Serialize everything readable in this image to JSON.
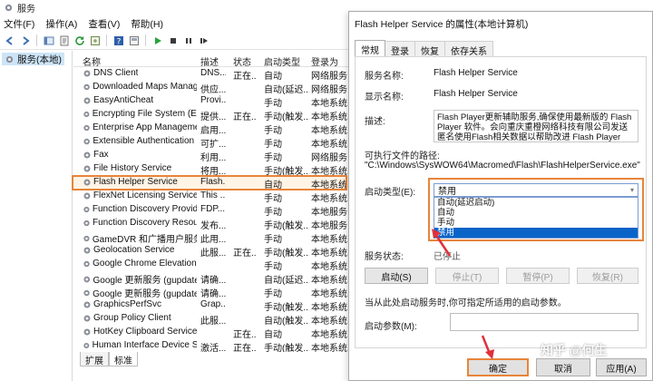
{
  "window": {
    "title": "服务",
    "menu": [
      "文件(F)",
      "操作(A)",
      "查看(V)",
      "帮助(H)"
    ],
    "tree_item": "服务(本地)",
    "bottom_tabs": [
      "扩展",
      "标准"
    ]
  },
  "columns": [
    "名称",
    "描述",
    "状态",
    "启动类型",
    "登录为"
  ],
  "services": [
    {
      "name": "DNS Client",
      "desc": "DNS...",
      "status": "正在...",
      "start": "自动",
      "logon": "网络服务"
    },
    {
      "name": "Downloaded Maps Manager",
      "desc": "供应...",
      "status": "",
      "start": "自动(延迟...",
      "logon": "网络服务"
    },
    {
      "name": "EasyAntiCheat",
      "desc": "Provi...",
      "status": "",
      "start": "手动",
      "logon": "本地系统"
    },
    {
      "name": "Encrypting File System (EFS)",
      "desc": "提供...",
      "status": "正在...",
      "start": "手动(触发...",
      "logon": "本地系统"
    },
    {
      "name": "Enterprise App Manageme...",
      "desc": "启用...",
      "status": "",
      "start": "手动",
      "logon": "本地系统"
    },
    {
      "name": "Extensible Authentication ...",
      "desc": "可扩...",
      "status": "",
      "start": "手动",
      "logon": "本地系统"
    },
    {
      "name": "Fax",
      "desc": "利用...",
      "status": "",
      "start": "手动",
      "logon": "网络服务"
    },
    {
      "name": "File History Service",
      "desc": "将用...",
      "status": "",
      "start": "手动(触发...",
      "logon": "本地系统"
    },
    {
      "name": "Flash Helper Service",
      "desc": "Flash...",
      "status": "",
      "start": "自动",
      "logon": "本地系统"
    },
    {
      "name": "FlexNet Licensing Service",
      "desc": "This ...",
      "status": "",
      "start": "手动",
      "logon": "本地系统"
    },
    {
      "name": "Function Discovery Provide...",
      "desc": "FDP...",
      "status": "",
      "start": "手动",
      "logon": "本地服务"
    },
    {
      "name": "Function Discovery Resour...",
      "desc": "发布...",
      "status": "",
      "start": "手动(触发...",
      "logon": "本地服务"
    },
    {
      "name": "GameDVR 和广播用户服务...",
      "desc": "此用...",
      "status": "",
      "start": "手动",
      "logon": "本地系统"
    },
    {
      "name": "Geolocation Service",
      "desc": "此服...",
      "status": "正在...",
      "start": "手动(触发...",
      "logon": "本地系统"
    },
    {
      "name": "Google Chrome Elevation ...",
      "desc": "",
      "status": "",
      "start": "手动",
      "logon": "本地系统"
    },
    {
      "name": "Google 更新服务 (gupdate)",
      "desc": "请确...",
      "status": "",
      "start": "自动(延迟...",
      "logon": "本地系统"
    },
    {
      "name": "Google 更新服务 (gupdate...",
      "desc": "请确...",
      "status": "",
      "start": "手动",
      "logon": "本地系统"
    },
    {
      "name": "GraphicsPerfSvc",
      "desc": "Grap...",
      "status": "",
      "start": "手动(触发...",
      "logon": "本地系统"
    },
    {
      "name": "Group Policy Client",
      "desc": "此服...",
      "status": "",
      "start": "自动(触发...",
      "logon": "本地系统"
    },
    {
      "name": "HotKey Clipboard Service",
      "desc": "",
      "status": "正在...",
      "start": "自动",
      "logon": "本地系统"
    },
    {
      "name": "Human Interface Device Ser...",
      "desc": "激活...",
      "status": "正在...",
      "start": "手动(触发...",
      "logon": "本地系统"
    }
  ],
  "dialog": {
    "title": "Flash Helper Service 的属性(本地计算机)",
    "tabs": [
      "常规",
      "登录",
      "恢复",
      "依存关系"
    ],
    "service_name_label": "服务名称:",
    "service_name": "Flash Helper Service",
    "display_name_label": "显示名称:",
    "display_name": "Flash Helper Service",
    "desc_label": "描述:",
    "description": "Flash Player更新辅助服务,确保使用最新版的 Flash Player 软件。会向重庆重橙网络科技有限公司发送匿名使用Flash相关数据以帮助改进 Flash Player",
    "path_label": "可执行文件的路径:",
    "path": "\"C:\\Windows\\SysWOW64\\Macromed\\Flash\\FlashHelperService.exe\"",
    "startup_label": "启动类型(E):",
    "startup_selected": "禁用",
    "startup_options": [
      "自动(延迟启动)",
      "自动",
      "手动",
      "禁用"
    ],
    "status_label": "服务状态:",
    "status_value": "已停止",
    "btn_start": "启动(S)",
    "btn_stop": "停止(T)",
    "btn_pause": "暂停(P)",
    "btn_resume": "恢复(R)",
    "hint": "当从此处启动服务时,你可指定所适用的启动参数。",
    "param_label": "启动参数(M):",
    "ok": "确定",
    "cancel": "取消",
    "apply": "应用(A)"
  },
  "watermark": "知乎 @何生",
  "colors": {
    "highlight": "#e8843a",
    "selection": "#0a64c8",
    "arrow": "#e0303b"
  }
}
